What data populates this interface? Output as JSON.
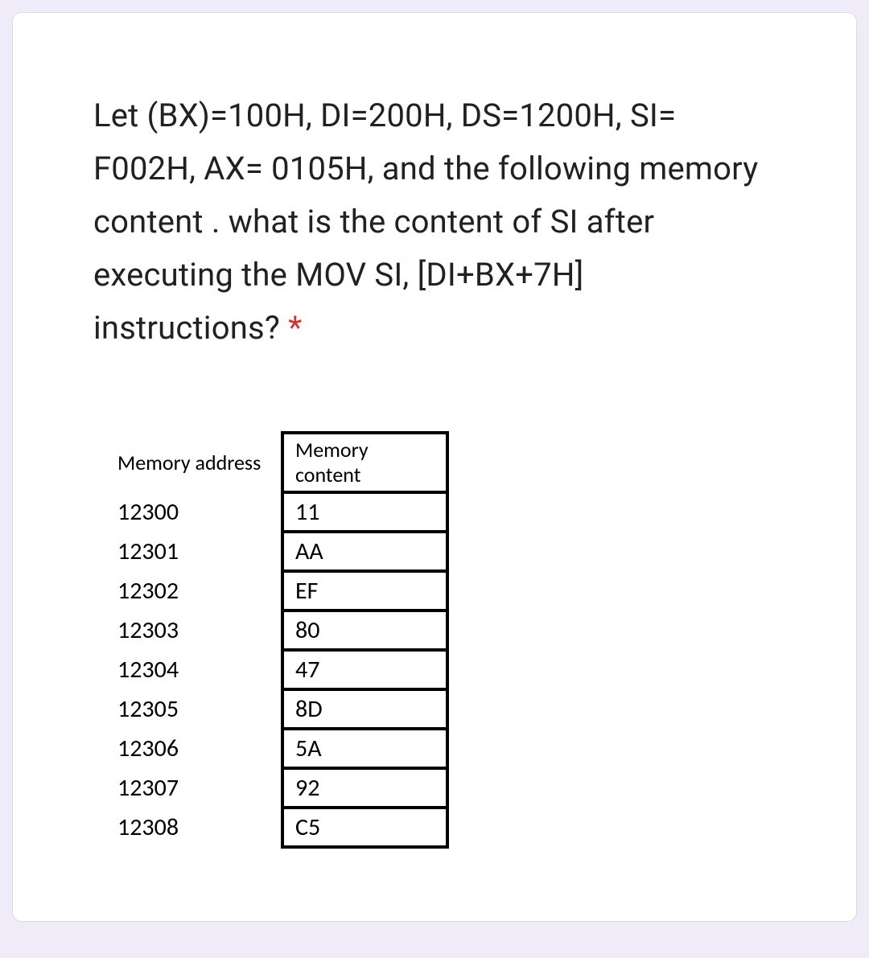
{
  "question": {
    "text": "Let (BX)=100H, DI=200H, DS=1200H, SI= F002H, AX= 0105H, and the following memory content . what is the content of SI after executing the MOV SI, [DI+BX+7H] instructions?",
    "required_marker": "*"
  },
  "memory_table": {
    "headers": {
      "address": "Memory address",
      "content": "Memory content"
    },
    "rows": [
      {
        "address": "12300",
        "content": "11"
      },
      {
        "address": "12301",
        "content": "AA"
      },
      {
        "address": "12302",
        "content": "EF"
      },
      {
        "address": "12303",
        "content": "80"
      },
      {
        "address": "12304",
        "content": "47"
      },
      {
        "address": "12305",
        "content": "8D"
      },
      {
        "address": "12306",
        "content": "5A"
      },
      {
        "address": "12307",
        "content": "92"
      },
      {
        "address": "12308",
        "content": "C5"
      }
    ]
  }
}
